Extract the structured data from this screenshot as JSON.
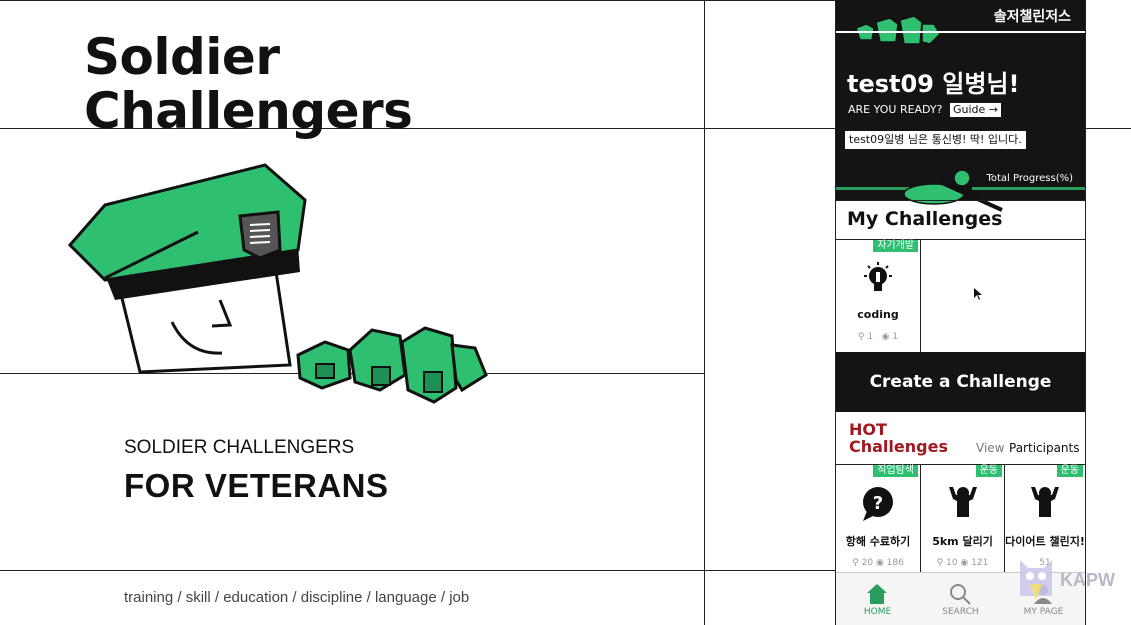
{
  "brand": {
    "title_line1": "Soldier",
    "title_line2": "Challengers",
    "subtitle_small": "SOLDIER CHALLENGERS",
    "subtitle_big": "FOR VETERANS",
    "tags": "training / skill / education / discipline / language / job"
  },
  "app": {
    "title": "솔저챌린저스",
    "greeting": "test09 일병님!",
    "ready_text": "ARE YOU READY?",
    "guide_label": "Guide →",
    "role_text": "test09일병 님은 통신병! 딱! 입니다.",
    "progress_label": "Total Progress(%)",
    "my_challenges_title": "My Challenges",
    "my_challenges": [
      {
        "category": "자기개발",
        "name": "coding",
        "participants": "1",
        "views": "1",
        "icon": "lightbulb-icon"
      }
    ],
    "create_button": "Create a Challenge",
    "hot_title_line1": "HOT",
    "hot_title_line2": "Challenges",
    "view_label": "View",
    "participants_label": "Participants",
    "hot_challenges": [
      {
        "category": "직업탐색",
        "name": "항해 수료하기",
        "participants": "20",
        "views": "186",
        "icon": "question-bubble-icon"
      },
      {
        "category": "운동",
        "name": "5km 달리기",
        "participants": "10",
        "views": "121",
        "icon": "strongman-icon"
      },
      {
        "category": "운동",
        "name": "다이어트 챌린지!",
        "participants": "",
        "views": "51",
        "icon": "strongman-icon"
      }
    ],
    "nav": [
      {
        "label": "HOME",
        "icon": "home-icon"
      },
      {
        "label": "SEARCH",
        "icon": "search-icon"
      },
      {
        "label": "MY PAGE",
        "icon": "user-icon"
      }
    ],
    "colors": {
      "accent_green": "#2fbf71",
      "dark": "#141414",
      "hot_red": "#a3171f"
    }
  },
  "watermark": {
    "text": "KAPW"
  }
}
